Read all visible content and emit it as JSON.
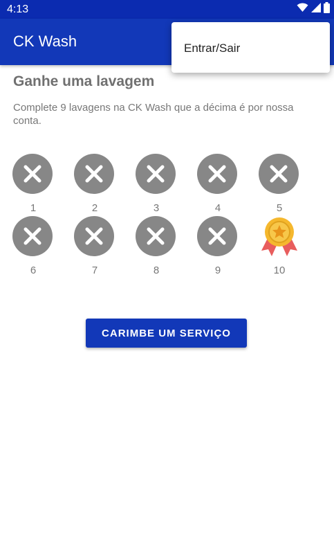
{
  "status_bar": {
    "time": "4:13"
  },
  "app_bar": {
    "title": "CK Wash"
  },
  "overflow_menu": {
    "items": [
      {
        "label": "Entrar/Sair"
      }
    ]
  },
  "card": {
    "heading": "Ganhe uma lavagem",
    "description": "Complete 9 lavagens na CK Wash que a décima é por nossa conta."
  },
  "stamps": [
    {
      "number": "1",
      "state": "empty"
    },
    {
      "number": "2",
      "state": "empty"
    },
    {
      "number": "3",
      "state": "empty"
    },
    {
      "number": "4",
      "state": "empty"
    },
    {
      "number": "5",
      "state": "empty"
    },
    {
      "number": "6",
      "state": "empty"
    },
    {
      "number": "7",
      "state": "empty"
    },
    {
      "number": "8",
      "state": "empty"
    },
    {
      "number": "9",
      "state": "empty"
    },
    {
      "number": "10",
      "state": "reward"
    }
  ],
  "action_button": {
    "label": "CARIMBE UM SERVIÇO"
  },
  "colors": {
    "primary": "#1238b8",
    "status_bar": "#0b2bb0",
    "stamp_empty": "#878787",
    "reward_gold": "#f5b82e",
    "reward_ribbon": "#e85d5d"
  }
}
